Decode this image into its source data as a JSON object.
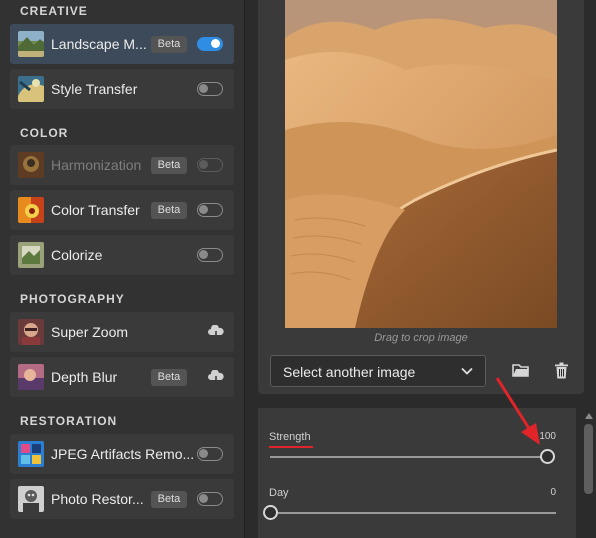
{
  "sections": {
    "creative": "CREATIVE",
    "color": "COLOR",
    "photography": "PHOTOGRAPHY",
    "restoration": "RESTORATION"
  },
  "filters": {
    "landscape_mixer": {
      "label": "Landscape M...",
      "beta": "Beta",
      "toggle": "on",
      "thumb": "landscape-thumbnail-icon"
    },
    "style_transfer": {
      "label": "Style Transfer",
      "toggle": "off",
      "thumb": "style-transfer-thumbnail-icon"
    },
    "harmonization": {
      "label": "Harmonization",
      "beta": "Beta",
      "toggle": "disabled",
      "thumb": "harmonization-thumbnail-icon"
    },
    "color_transfer": {
      "label": "Color Transfer",
      "beta": "Beta",
      "toggle": "off",
      "thumb": "color-transfer-thumbnail-icon"
    },
    "colorize": {
      "label": "Colorize",
      "toggle": "off",
      "thumb": "colorize-thumbnail-icon"
    },
    "super_zoom": {
      "label": "Super Zoom",
      "action": "cloud-download-icon",
      "thumb": "super-zoom-thumbnail-icon"
    },
    "depth_blur": {
      "label": "Depth Blur",
      "beta": "Beta",
      "action": "cloud-download-icon",
      "thumb": "depth-blur-thumbnail-icon"
    },
    "jpeg_artifacts": {
      "label": "JPEG Artifacts Remo...",
      "toggle": "off",
      "thumb": "jpeg-artifacts-thumbnail-icon"
    },
    "photo_restoration": {
      "label": "Photo Restor...",
      "beta": "Beta",
      "toggle": "off",
      "thumb": "photo-restoration-thumbnail-icon"
    }
  },
  "preview": {
    "crop_hint": "Drag to crop image",
    "select_label": "Select another image"
  },
  "settings": {
    "strength": {
      "label": "Strength",
      "value": "100",
      "fraction": 1.0
    },
    "day": {
      "label": "Day",
      "value": "0",
      "fraction": 0.0
    }
  },
  "colors": {
    "toggle_on": "#2f8de4",
    "annotation": "#e0242a"
  }
}
